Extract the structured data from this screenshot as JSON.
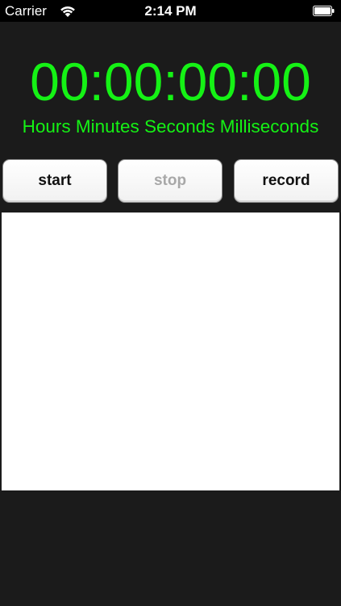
{
  "status_bar": {
    "carrier": "Carrier",
    "time": "2:14 PM",
    "icons": [
      "wifi-icon",
      "battery-icon"
    ]
  },
  "timer": {
    "display": "00:00:00:00",
    "units": "Hours Minutes Seconds Milliseconds",
    "color": "#15f215"
  },
  "buttons": {
    "start": "start",
    "stop": "stop",
    "record": "record"
  },
  "colors": {
    "background": "#1b1b1b",
    "status_bar": "#000000",
    "list_background": "#ffffff",
    "disabled_text": "#a8a8a8"
  }
}
